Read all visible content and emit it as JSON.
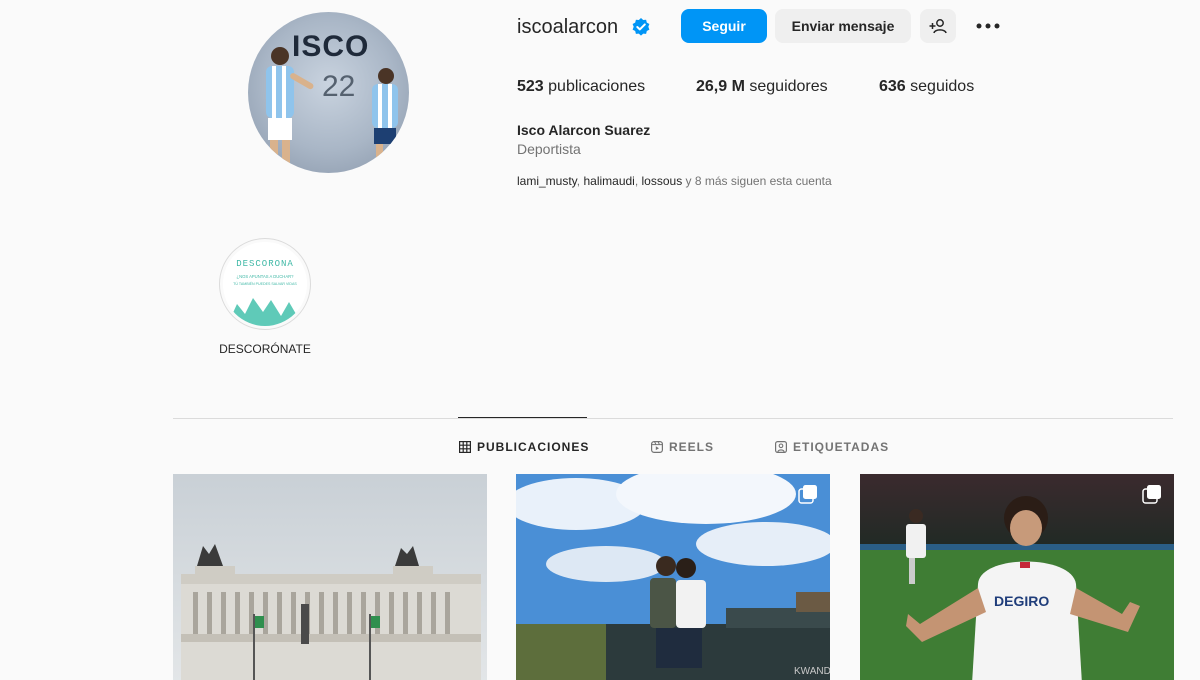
{
  "profile": {
    "username": "iscoalarcon",
    "avatar_text": "ISCO",
    "avatar_number": "22",
    "full_name": "Isco Alarcon Suarez",
    "category": "Deportista"
  },
  "actions": {
    "follow": "Seguir",
    "message": "Enviar mensaje",
    "suggest_icon": "add-person-icon",
    "more_icon": "more-options-icon"
  },
  "stats": {
    "posts_value": "523",
    "posts_label": "publicaciones",
    "followers_value": "26,9 M",
    "followers_label": "seguidores",
    "following_value": "636",
    "following_label": "seguidos"
  },
  "followed_by": {
    "names": [
      "lami_musty",
      "halimaudi",
      "lossous"
    ],
    "suffix": "y 8 más siguen esta cuenta"
  },
  "highlights": [
    {
      "label": "DESCORÓNATE",
      "cover_title": "DESCORONA",
      "cover_line1": "¿NOS APUNTAS A DUCHAR?",
      "cover_line2": "TÚ TAMBIÉN PUEDES SALVAR VIDAS"
    }
  ],
  "tabs": [
    {
      "label": "PUBLICACIONES",
      "icon": "grid-icon",
      "active": true
    },
    {
      "label": "REELS",
      "icon": "reels-icon",
      "active": false
    },
    {
      "label": "ETIQUETADAS",
      "icon": "tagged-icon",
      "active": false
    }
  ],
  "posts": [
    {
      "subject": "Roman monument building under cloudy sky",
      "multi": false
    },
    {
      "subject": "Couple kissing on safari vehicle",
      "multi": true,
      "sign_text": "KWANDO"
    },
    {
      "subject": "Footballer celebrating in white jersey",
      "multi": true,
      "jersey_text": "DEGIRO"
    }
  ],
  "colors": {
    "accent": "#0095f6",
    "verified": "#0095f6",
    "text": "#262626",
    "secondary": "#737373"
  }
}
